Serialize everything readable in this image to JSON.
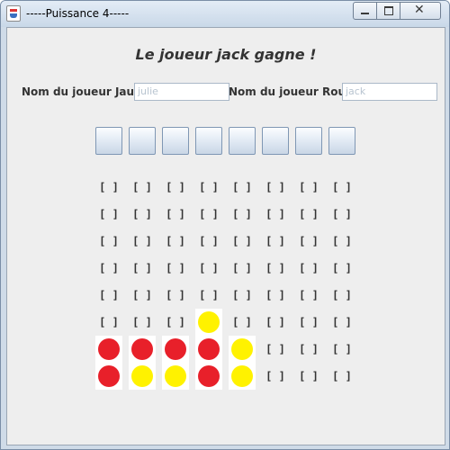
{
  "window": {
    "title": "-----Puissance 4-----"
  },
  "status": {
    "message": "Le joueur jack gagne !"
  },
  "players": {
    "yellow": {
      "label": "Nom du joueur Jaune",
      "value": "julie"
    },
    "red": {
      "label": "Nom du joueur Rouge",
      "value": "jack"
    }
  },
  "board": {
    "columns": 8,
    "rows": 8,
    "empty_text": "[ ]",
    "colors": {
      "red": "#e8202a",
      "yellow": "#fff200"
    },
    "cells": [
      [
        "empty",
        "empty",
        "empty",
        "empty",
        "empty",
        "empty",
        "empty",
        "empty"
      ],
      [
        "empty",
        "empty",
        "empty",
        "empty",
        "empty",
        "empty",
        "empty",
        "empty"
      ],
      [
        "empty",
        "empty",
        "empty",
        "empty",
        "empty",
        "empty",
        "empty",
        "empty"
      ],
      [
        "empty",
        "empty",
        "empty",
        "empty",
        "empty",
        "empty",
        "empty",
        "empty"
      ],
      [
        "empty",
        "empty",
        "empty",
        "empty",
        "empty",
        "empty",
        "empty",
        "empty"
      ],
      [
        "empty",
        "empty",
        "empty",
        "yellow",
        "empty",
        "empty",
        "empty",
        "empty"
      ],
      [
        "red",
        "red",
        "red",
        "red",
        "yellow",
        "empty",
        "empty",
        "empty"
      ],
      [
        "red",
        "yellow",
        "yellow",
        "red",
        "yellow",
        "empty",
        "empty",
        "empty"
      ]
    ]
  }
}
